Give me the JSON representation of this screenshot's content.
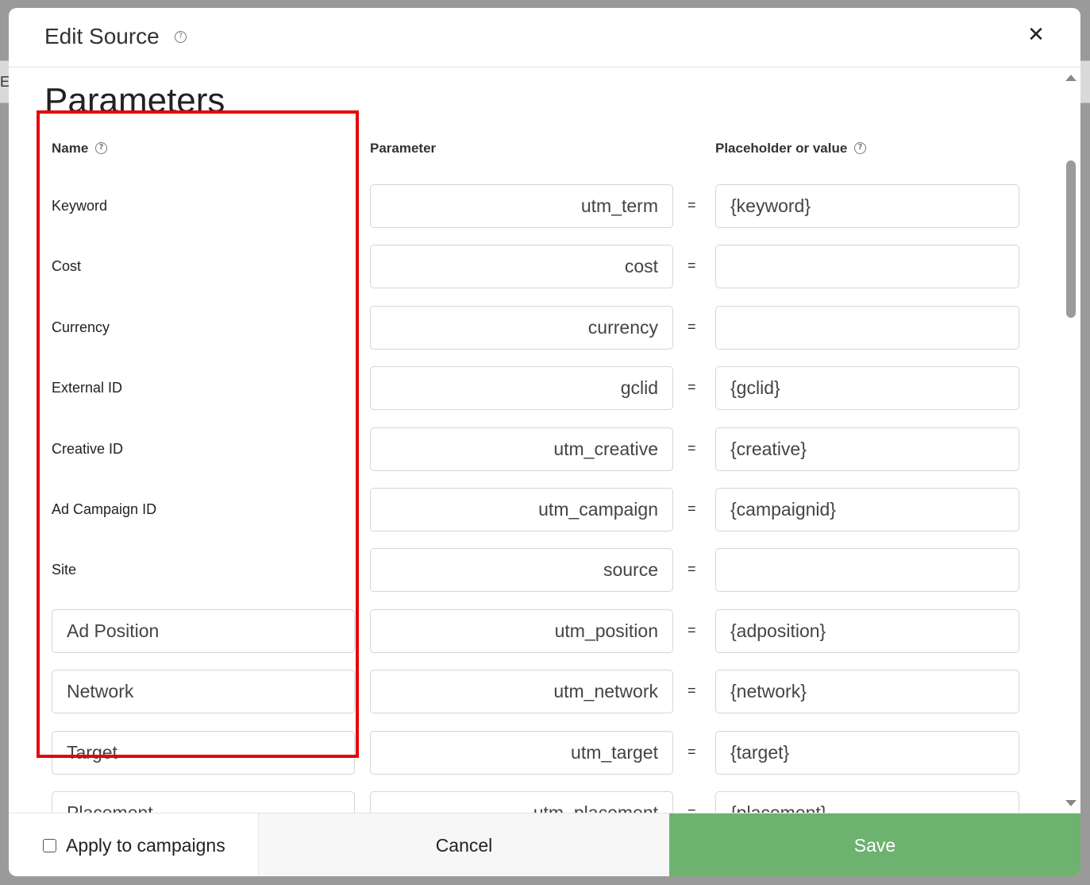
{
  "modal": {
    "title": "Edit Source",
    "close_icon": "close-icon"
  },
  "parameters": {
    "section_title": "Parameters",
    "columns": {
      "name": "Name",
      "parameter": "Parameter",
      "value": "Placeholder or value"
    },
    "equals": "=",
    "rows": [
      {
        "name": "Keyword",
        "name_editable": false,
        "parameter": "utm_term",
        "value": "{keyword}"
      },
      {
        "name": "Cost",
        "name_editable": false,
        "parameter": "cost",
        "value": ""
      },
      {
        "name": "Currency",
        "name_editable": false,
        "parameter": "currency",
        "value": ""
      },
      {
        "name": "External ID",
        "name_editable": false,
        "parameter": "gclid",
        "value": "{gclid}"
      },
      {
        "name": "Creative ID",
        "name_editable": false,
        "parameter": "utm_creative",
        "value": "{creative}"
      },
      {
        "name": "Ad Campaign ID",
        "name_editable": false,
        "parameter": "utm_campaign",
        "value": "{campaignid}"
      },
      {
        "name": "Site",
        "name_editable": false,
        "parameter": "source",
        "value": ""
      },
      {
        "name": "Ad Position",
        "name_editable": true,
        "parameter": "utm_position",
        "value": "{adposition}"
      },
      {
        "name": "Network",
        "name_editable": true,
        "parameter": "utm_network",
        "value": "{network}"
      },
      {
        "name": "Target",
        "name_editable": true,
        "parameter": "utm_target",
        "value": "{target}"
      },
      {
        "name": "Placement",
        "name_editable": true,
        "parameter": "utm_placement",
        "value": "{placement}"
      }
    ]
  },
  "footer": {
    "apply_label": "Apply to campaigns",
    "apply_checked": false,
    "cancel_label": "Cancel",
    "save_label": "Save"
  },
  "colors": {
    "save_button": "#6db26f",
    "highlight": "#e8000b"
  }
}
